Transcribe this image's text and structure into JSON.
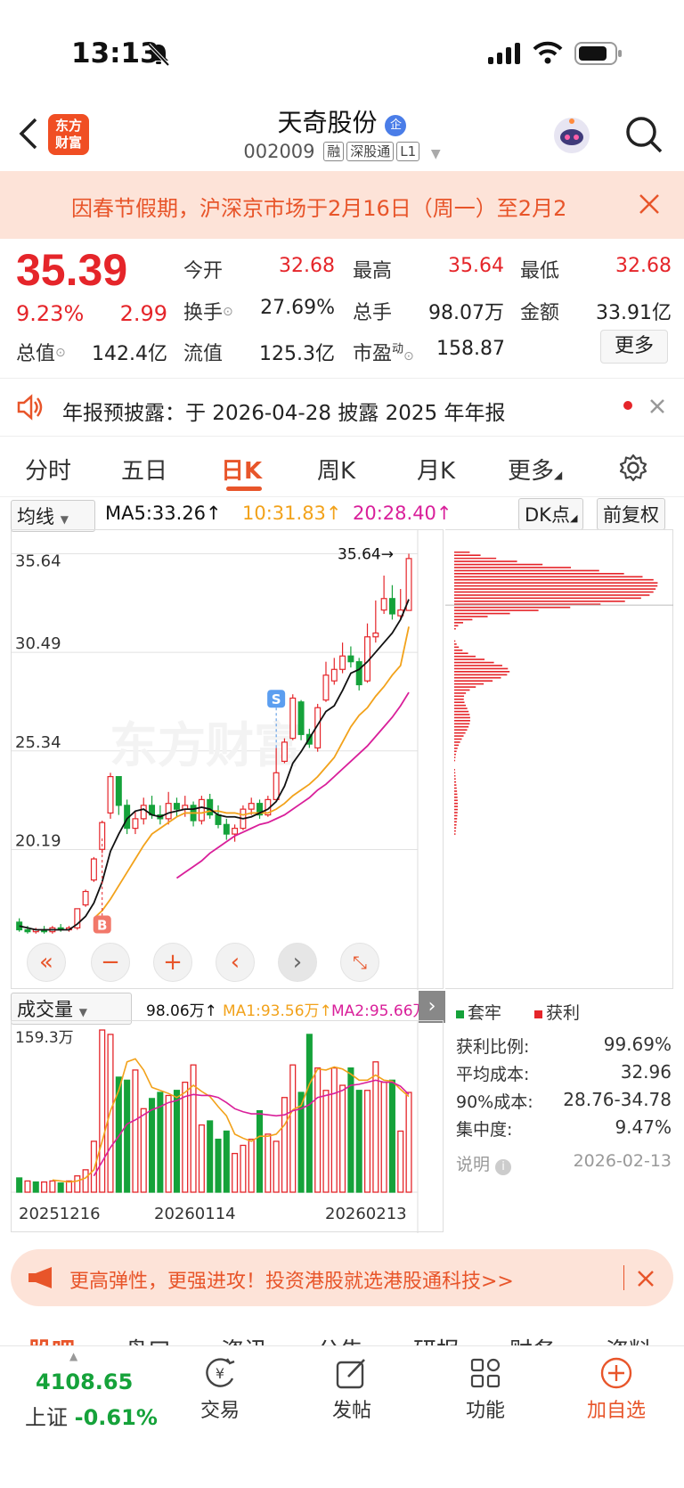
{
  "status": {
    "time": "13:13"
  },
  "header": {
    "back": "<",
    "logo_line1": "东方",
    "logo_line2": "财富",
    "title": "天奇股份",
    "title_badge": "企",
    "code": "002009",
    "tags": [
      "融",
      "深股通",
      "L1"
    ]
  },
  "banner": {
    "text": "因春节假期，沪深京市场于2月16日（周一）至2月2"
  },
  "quote": {
    "price": "35.39",
    "change_pct": "9.23%",
    "change": "2.99",
    "rows": [
      [
        {
          "label": "今开",
          "value": "32.68",
          "color": "red"
        },
        {
          "label": "最高",
          "value": "35.64",
          "color": "red"
        },
        {
          "label": "最低",
          "value": "32.68",
          "color": "red"
        }
      ],
      [
        {
          "label": "换手",
          "value": "27.69%",
          "color": "dark"
        },
        {
          "label": "总手",
          "value": "98.07万",
          "color": "dark"
        },
        {
          "label": "金额",
          "value": "33.91亿",
          "color": "dark"
        }
      ],
      [
        {
          "label": "总值",
          "value": "142.4亿",
          "color": "dark"
        },
        {
          "label": "流值",
          "value": "125.3亿",
          "color": "dark"
        },
        {
          "label": "市盈",
          "value": "158.87",
          "color": "dark"
        }
      ]
    ],
    "pe_sup": "动",
    "more": "更多"
  },
  "notice": {
    "text": "年报预披露：于 2026-04-28 披露 2025 年年报"
  },
  "tabs": [
    "分时",
    "五日",
    "日K",
    "周K",
    "月K",
    "更多"
  ],
  "ma_bar": {
    "selector": "均线",
    "ma5": "MA5:33.26↑",
    "ma10": "10:31.83↑",
    "ma20": "20:28.40↑",
    "dk": "DK点",
    "adjust": "前复权",
    "colors": {
      "ma5": "#111111",
      "ma10": "#f2a21b",
      "ma20": "#d91f9a"
    }
  },
  "chart_data": [
    {
      "type": "candlestick",
      "title": "",
      "yticks": [
        "35.64",
        "30.49",
        "25.34",
        "20.19"
      ],
      "ylim": [
        15.0,
        36.5
      ],
      "high_label": "35.64→",
      "buy_marker": "B",
      "sell_marker": "S",
      "candles": [
        [
          16.4,
          16.0,
          16.6,
          15.9
        ],
        [
          16.0,
          15.9,
          16.2,
          15.8
        ],
        [
          15.9,
          16.0,
          16.1,
          15.8
        ],
        [
          16.0,
          15.9,
          16.2,
          15.8
        ],
        [
          15.9,
          16.1,
          16.2,
          15.8
        ],
        [
          16.1,
          16.0,
          16.3,
          15.9
        ],
        [
          16.0,
          16.1,
          16.2,
          15.9
        ],
        [
          16.1,
          17.1,
          17.1,
          16.0
        ],
        [
          17.3,
          18.0,
          18.1,
          17.2
        ],
        [
          18.6,
          19.7,
          19.8,
          18.5
        ],
        [
          20.2,
          21.6,
          21.7,
          20.0
        ],
        [
          22.1,
          24.0,
          24.2,
          21.8
        ],
        [
          24.0,
          22.5,
          24.0,
          22.0
        ],
        [
          22.5,
          21.3,
          22.8,
          21.0
        ],
        [
          21.3,
          21.8,
          22.2,
          21.0
        ],
        [
          21.8,
          22.5,
          22.9,
          21.5
        ],
        [
          22.5,
          22.0,
          23.0,
          21.8
        ],
        [
          22.0,
          21.8,
          22.5,
          21.5
        ],
        [
          21.8,
          22.6,
          23.2,
          21.5
        ],
        [
          22.6,
          22.3,
          22.9,
          21.9
        ],
        [
          22.3,
          22.5,
          23.0,
          21.9
        ],
        [
          22.5,
          21.7,
          22.7,
          21.4
        ],
        [
          21.7,
          22.8,
          23.0,
          21.5
        ],
        [
          22.8,
          22.0,
          23.1,
          21.8
        ],
        [
          22.0,
          21.5,
          22.5,
          21.3
        ],
        [
          21.5,
          21.0,
          21.8,
          20.7
        ],
        [
          21.0,
          21.3,
          21.5,
          20.6
        ],
        [
          21.3,
          22.3,
          22.5,
          21.2
        ],
        [
          22.3,
          22.6,
          22.9,
          22.0
        ],
        [
          22.6,
          22.0,
          22.8,
          21.8
        ],
        [
          22.0,
          22.8,
          23.0,
          21.9
        ],
        [
          22.8,
          24.2,
          25.5,
          22.7
        ],
        [
          24.8,
          25.8,
          26.0,
          24.7
        ],
        [
          26.0,
          28.1,
          28.3,
          25.9
        ],
        [
          27.9,
          26.2,
          28.0,
          25.9
        ],
        [
          26.2,
          25.7,
          26.5,
          25.5
        ],
        [
          25.5,
          27.6,
          27.8,
          25.3
        ],
        [
          28.0,
          29.3,
          30.0,
          27.9
        ],
        [
          29.0,
          29.6,
          30.2,
          28.8
        ],
        [
          29.6,
          30.3,
          31.0,
          29.4
        ],
        [
          30.3,
          30.0,
          30.8,
          29.7
        ],
        [
          30.0,
          28.8,
          30.2,
          28.5
        ],
        [
          29.0,
          31.3,
          32.0,
          28.9
        ],
        [
          31.3,
          31.5,
          33.2,
          31.0
        ],
        [
          32.7,
          33.3,
          34.5,
          32.5
        ],
        [
          33.3,
          32.5,
          34.0,
          32.2
        ],
        [
          32.4,
          32.7,
          33.8,
          32.2
        ],
        [
          32.68,
          35.39,
          35.64,
          32.68
        ]
      ],
      "ma5": [
        16.2,
        16.1,
        16.0,
        16.0,
        16.0,
        16.0,
        16.0,
        16.3,
        16.7,
        17.4,
        18.5,
        20.1,
        21.0,
        21.8,
        22.2,
        22.3,
        22.0,
        21.9,
        22.1,
        22.2,
        22.3,
        22.3,
        22.4,
        22.3,
        22.0,
        21.9,
        21.9,
        21.8,
        21.9,
        22.1,
        22.3,
        22.7,
        23.5,
        24.7,
        25.3,
        26.0,
        26.7,
        27.4,
        27.7,
        28.5,
        29.4,
        29.6,
        30.0,
        30.5,
        31.0,
        31.5,
        32.2,
        33.26
      ],
      "ma10": [
        null,
        null,
        null,
        null,
        null,
        null,
        null,
        null,
        null,
        16.6,
        17.0,
        17.6,
        18.3,
        19.0,
        19.7,
        20.4,
        21.0,
        21.3,
        21.6,
        21.9,
        22.1,
        22.1,
        22.1,
        22.2,
        22.2,
        22.1,
        22.1,
        22.0,
        22.1,
        22.1,
        22.1,
        22.3,
        22.6,
        23.0,
        23.3,
        23.6,
        24.0,
        24.5,
        25.0,
        25.8,
        26.6,
        27.2,
        27.6,
        28.2,
        28.7,
        29.3,
        29.8,
        31.83
      ],
      "ma20": [
        null,
        null,
        null,
        null,
        null,
        null,
        null,
        null,
        null,
        null,
        null,
        null,
        null,
        null,
        null,
        null,
        null,
        null,
        null,
        18.7,
        19.0,
        19.3,
        19.6,
        20.0,
        20.3,
        20.6,
        20.9,
        21.1,
        21.3,
        21.5,
        21.6,
        21.8,
        22.0,
        22.3,
        22.6,
        22.9,
        23.3,
        23.6,
        24.0,
        24.4,
        24.8,
        25.2,
        25.6,
        26.1,
        26.6,
        27.1,
        27.7,
        28.4
      ]
    },
    {
      "type": "bar",
      "title": "",
      "ymax_label": "159.3万",
      "xticks": [
        "20251216",
        "20260114",
        "20260213"
      ],
      "ylim": [
        0,
        159.3
      ],
      "values": [
        14,
        11,
        10,
        10,
        11,
        9,
        11,
        16,
        22,
        50,
        160,
        155,
        113,
        110,
        120,
        82,
        92,
        98,
        95,
        100,
        108,
        125,
        66,
        70,
        52,
        60,
        38,
        46,
        52,
        80,
        57,
        50,
        93,
        125,
        98,
        155,
        122,
        100,
        122,
        105,
        122,
        100,
        100,
        128,
        108,
        110,
        60,
        98
      ],
      "up": [
        0,
        1,
        0,
        1,
        1,
        0,
        1,
        1,
        1,
        1,
        1,
        1,
        0,
        0,
        1,
        1,
        0,
        0,
        1,
        0,
        1,
        1,
        1,
        0,
        0,
        0,
        1,
        1,
        1,
        0,
        1,
        1,
        1,
        1,
        0,
        0,
        1,
        1,
        1,
        1,
        0,
        0,
        1,
        1,
        1,
        0,
        1,
        1
      ],
      "ma1": [
        null,
        null,
        null,
        null,
        12,
        11,
        10,
        11,
        14,
        22,
        50,
        80,
        100,
        128,
        131,
        120,
        103,
        100,
        97,
        93,
        98,
        105,
        99,
        94,
        84,
        75,
        57,
        53,
        50,
        55,
        55,
        57,
        66,
        81,
        85,
        106,
        121,
        120,
        123,
        121,
        116,
        110,
        110,
        115,
        110,
        109,
        101,
        94
      ],
      "ma2": [
        null,
        null,
        null,
        null,
        null,
        null,
        null,
        null,
        null,
        16,
        30,
        44,
        55,
        67,
        71,
        76,
        81,
        84,
        88,
        90,
        94,
        96,
        95,
        95,
        93,
        88,
        82,
        79,
        77,
        77,
        76,
        75,
        76,
        80,
        82,
        86,
        93,
        95,
        97,
        100,
        105,
        106,
        108,
        110,
        108,
        108,
        104,
        96
      ]
    }
  ],
  "vol_bar": {
    "selector": "成交量",
    "vol": "98.06万↑",
    "ma1": "MA1:93.56万↑",
    "ma2": "MA2:95.66万"
  },
  "cost_dist": {
    "legend_trapped": "套牢",
    "legend_profit": "获利",
    "stats": [
      {
        "label": "获利比例:",
        "value": "99.69%"
      },
      {
        "label": "平均成本:",
        "value": "32.96"
      },
      {
        "label": "90%成本:",
        "value": "28.76-34.78"
      },
      {
        "label": "集中度:",
        "value": "9.47%"
      }
    ],
    "note_label": "说明",
    "date": "2026-02-13"
  },
  "ad": {
    "text": "更高弹性，更强进攻！投资港股就选港股通科技>>"
  },
  "bottom_tabs_partial": [
    "股吧",
    "盘口",
    "资讯",
    "公告",
    "研报",
    "财务",
    "资料"
  ],
  "bottom_nav": {
    "index_value": "4108.65",
    "index_name": "上证",
    "index_change": "-0.61%",
    "items": [
      {
        "label": "交易",
        "icon": "trade-icon"
      },
      {
        "label": "发帖",
        "icon": "post-icon"
      },
      {
        "label": "功能",
        "icon": "functions-icon"
      },
      {
        "label": "加自选",
        "icon": "add-watchlist-icon"
      }
    ]
  }
}
